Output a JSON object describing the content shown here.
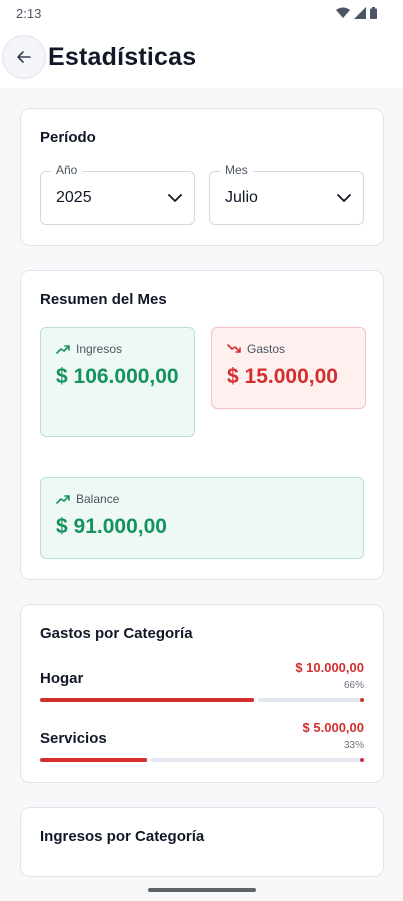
{
  "status_bar": {
    "time": "2:13",
    "icons": [
      "wifi-icon",
      "signal-icon",
      "battery-icon"
    ]
  },
  "app_bar": {
    "title": "Estadísticas",
    "back_icon": "arrow-left-icon"
  },
  "periodo": {
    "title": "Período",
    "year": {
      "label": "Año",
      "value": "2025"
    },
    "month": {
      "label": "Mes",
      "value": "Julio"
    }
  },
  "resumen": {
    "title": "Resumen del Mes",
    "ingresos": {
      "label": "Ingresos",
      "value": "$ 106.000,00",
      "icon": "trending-up-icon",
      "color": "#14935e"
    },
    "gastos": {
      "label": "Gastos",
      "value": "$ 15.000,00",
      "icon": "trending-down-icon",
      "color": "#d32f2f"
    },
    "balance": {
      "label": "Balance",
      "value": "$ 91.000,00",
      "icon": "trending-up-icon",
      "color": "#14935e"
    }
  },
  "gastos_categoria": {
    "title": "Gastos por Categoría",
    "items": [
      {
        "name": "Hogar",
        "amount": "$ 10.000,00",
        "percent_label": "66%",
        "fraction": 0.66
      },
      {
        "name": "Servicios",
        "amount": "$ 5.000,00",
        "percent_label": "33%",
        "fraction": 0.33
      }
    ]
  },
  "ingresos_categoria": {
    "title": "Ingresos por Categoría"
  },
  "colors": {
    "income": "#14935e",
    "expense": "#d32f2f",
    "track": "#e3e7ee"
  }
}
